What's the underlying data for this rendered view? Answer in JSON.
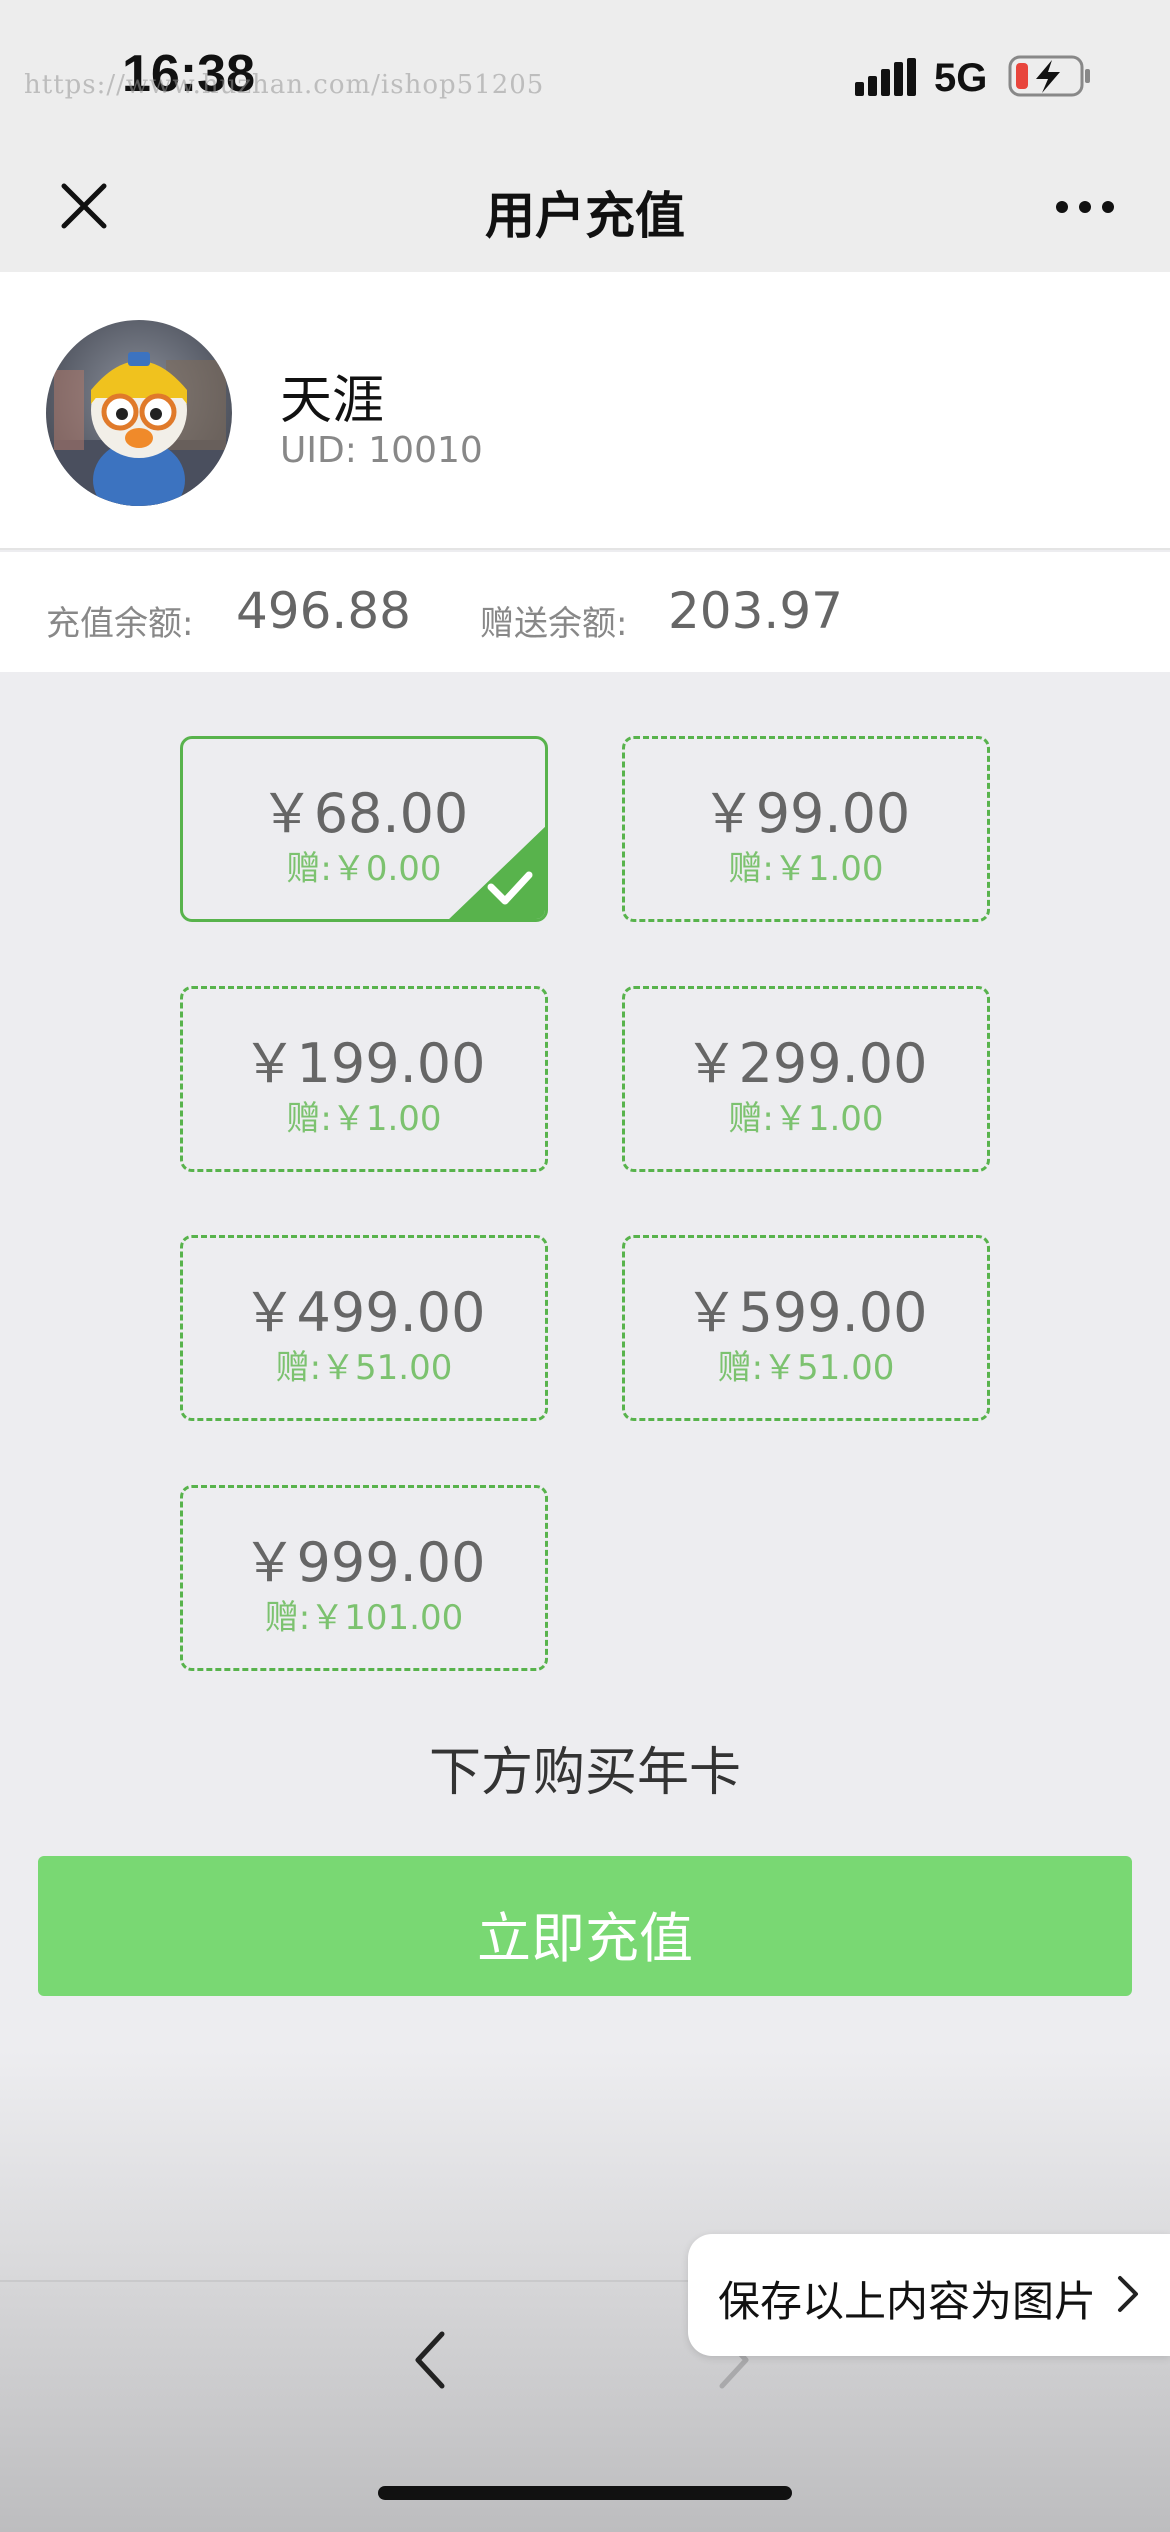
{
  "status_bar": {
    "time": "16:38",
    "watermark": "https://www.huzhan.com/ishop51205",
    "network": "5G"
  },
  "nav": {
    "title": "用户充值"
  },
  "user": {
    "name": "天涯",
    "uid": "UID: 10010"
  },
  "balance": {
    "recharge_label": "充值余额:",
    "recharge_value": "496.88",
    "gift_label": "赠送余额:",
    "gift_value": "203.97"
  },
  "options": [
    {
      "price": "￥68.00",
      "bonus": "赠:￥0.00",
      "selected": true
    },
    {
      "price": "￥99.00",
      "bonus": "赠:￥1.00",
      "selected": false
    },
    {
      "price": "￥199.00",
      "bonus": "赠:￥1.00",
      "selected": false
    },
    {
      "price": "￥299.00",
      "bonus": "赠:￥1.00",
      "selected": false
    },
    {
      "price": "￥499.00",
      "bonus": "赠:￥51.00",
      "selected": false
    },
    {
      "price": "￥599.00",
      "bonus": "赠:￥51.00",
      "selected": false
    },
    {
      "price": "￥999.00",
      "bonus": "赠:￥101.00",
      "selected": false
    }
  ],
  "yearcard_link": "下方购买年卡",
  "recharge_button": "立即充值",
  "save_image": "保存以上内容为图片",
  "colors": {
    "accent_green": "#58b34c",
    "button_green": "#79d873",
    "bonus_green": "#7cc26f"
  }
}
